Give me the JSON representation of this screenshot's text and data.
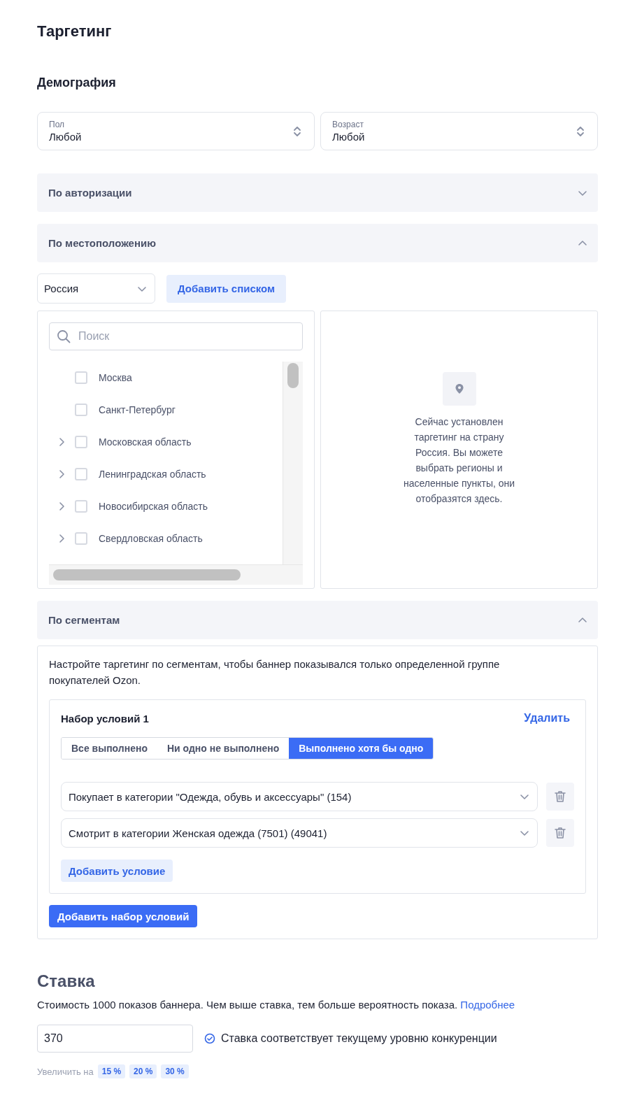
{
  "title": "Таргетинг",
  "demography": {
    "title": "Демография",
    "selects": [
      {
        "label": "Пол",
        "value": "Любой"
      },
      {
        "label": "Возраст",
        "value": "Любой"
      }
    ]
  },
  "authorization": {
    "title": "По авторизации",
    "expanded": false
  },
  "location": {
    "title": "По местоположению",
    "expanded": true,
    "country": "Россия",
    "add_list_button": "Добавить списком",
    "search_placeholder": "Поиск",
    "regions": [
      {
        "name": "Москва",
        "expandable": false,
        "checked": false
      },
      {
        "name": "Санкт-Петербург",
        "expandable": false,
        "checked": false
      },
      {
        "name": "Московская область",
        "expandable": true,
        "checked": false
      },
      {
        "name": "Ленинградская область",
        "expandable": true,
        "checked": false
      },
      {
        "name": "Новосибирская область",
        "expandable": true,
        "checked": false
      },
      {
        "name": "Свердловская область",
        "expandable": true,
        "checked": false
      }
    ],
    "empty_note": "Сейчас установлен таргетинг на страну Россия. Вы можете выбрать регионы и населенные пункты, они отобразятся здесь."
  },
  "segments": {
    "title": "По сегментам",
    "expanded": true,
    "description": "Настройте таргетинг по сегментам, чтобы баннер показывался только определенной группе покупателей Ozon.",
    "condition_sets": [
      {
        "title": "Набор условий 1",
        "delete_link": "Удалить",
        "modes": [
          {
            "label": "Все выполнено",
            "selected": false
          },
          {
            "label": "Ни одно не выполнено",
            "selected": false
          },
          {
            "label": "Выполнено хотя бы одно",
            "selected": true
          }
        ],
        "conditions": [
          {
            "value": "Покупает в категории \"Одежда, обувь и аксессуары\" (154)"
          },
          {
            "value": "Смотрит в категории Женская одежда (7501) (49041)"
          }
        ],
        "add_condition_button": "Добавить условие"
      }
    ],
    "add_set_button": "Добавить набор условий"
  },
  "bid": {
    "title": "Ставка",
    "description": "Стоимость 1000 показов баннера. Чем выше ставка, тем больше вероятность показа.",
    "more_link": "Подробнее",
    "value": "370",
    "status": "Ставка соответствует текущему уровню конкуренции",
    "increase_label": "Увеличить на",
    "increase_options": [
      "15 %",
      "20 %",
      "30 %"
    ]
  }
}
